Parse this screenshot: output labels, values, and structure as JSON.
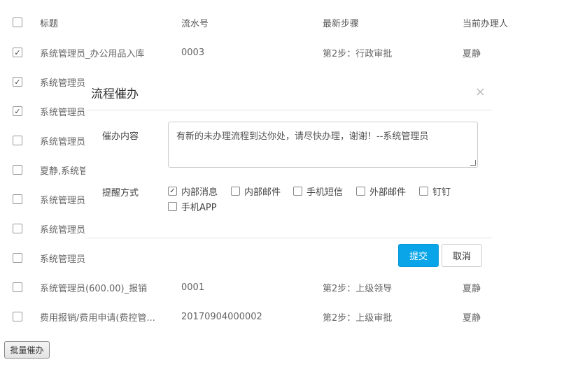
{
  "table": {
    "headers": {
      "title": "标题",
      "serial": "流水号",
      "step": "最新步骤",
      "handler": "当前办理人"
    },
    "rows": [
      {
        "checked": true,
        "title": "系统管理员_办公用品入库",
        "serial": "0003",
        "step": "第2步：行政审批",
        "handler": "夏静"
      },
      {
        "checked": true,
        "title": "系统管理员",
        "serial": "",
        "step": "",
        "handler": ""
      },
      {
        "checked": true,
        "title": "系统管理员",
        "serial": "",
        "step": "",
        "handler": ""
      },
      {
        "checked": false,
        "title": "系统管理员",
        "serial": "",
        "step": "",
        "handler": ""
      },
      {
        "checked": false,
        "title": "夏静,系统管",
        "serial": "",
        "step": "",
        "handler": ""
      },
      {
        "checked": false,
        "title": "系统管理员",
        "serial": "",
        "step": "",
        "handler": ""
      },
      {
        "checked": false,
        "title": "系统管理员",
        "serial": "",
        "step": "",
        "handler": ""
      },
      {
        "checked": false,
        "title": "系统管理员",
        "serial": "",
        "step": "",
        "handler": ""
      },
      {
        "checked": false,
        "title": "系统管理员(600.00)_报销",
        "serial": "0001",
        "step": "第2步：上级领导",
        "handler": "夏静"
      },
      {
        "checked": false,
        "title": "费用报销/费用申请(费控管...",
        "serial": "20170904000002",
        "step": "第2步：上级审批",
        "handler": "夏静"
      }
    ]
  },
  "batch_button_label": "批量催办",
  "modal": {
    "title": "流程催办",
    "close_glyph": "×",
    "content_label": "催办内容",
    "content_value": "有新的未办理流程到达你处，请尽快办理，谢谢！--系统管理员",
    "remind_label": "提醒方式",
    "options": [
      {
        "label": "内部消息",
        "checked": true
      },
      {
        "label": "内部邮件",
        "checked": false
      },
      {
        "label": "手机短信",
        "checked": false
      },
      {
        "label": "外部邮件",
        "checked": false
      },
      {
        "label": "钉钉",
        "checked": false
      },
      {
        "label": "手机APP",
        "checked": false
      }
    ],
    "submit_label": "提交",
    "cancel_label": "取消"
  },
  "check_glyph": "✓",
  "colors": {
    "primary": "#0aa5e8"
  }
}
